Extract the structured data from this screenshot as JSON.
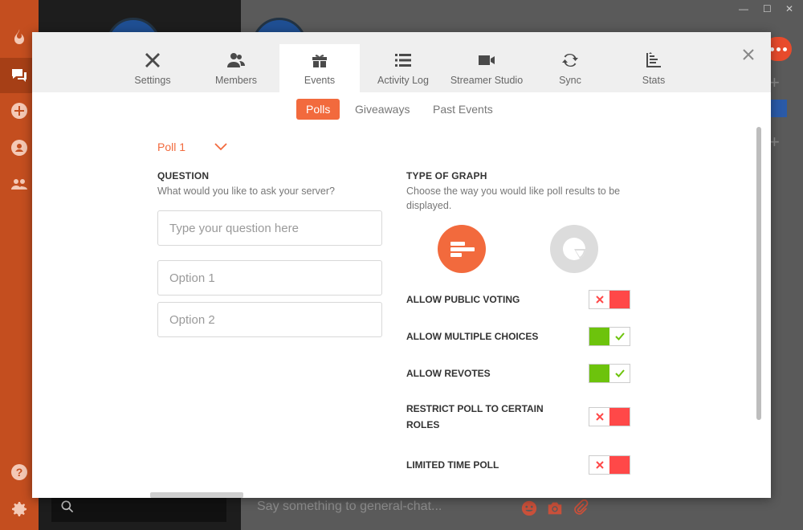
{
  "tabs": [
    {
      "label": "Settings",
      "icon": "tools-icon"
    },
    {
      "label": "Members",
      "icon": "members-icon"
    },
    {
      "label": "Events",
      "icon": "gift-icon",
      "active": true
    },
    {
      "label": "Activity Log",
      "icon": "list-icon"
    },
    {
      "label": "Streamer Studio",
      "icon": "video-camera-icon"
    },
    {
      "label": "Sync",
      "icon": "sync-icon"
    },
    {
      "label": "Stats",
      "icon": "stats-icon"
    }
  ],
  "subtabs": [
    {
      "label": "Polls",
      "active": true
    },
    {
      "label": "Giveaways"
    },
    {
      "label": "Past Events"
    }
  ],
  "poll": {
    "selected": "Poll 1",
    "question_title": "QUESTION",
    "question_sub": "What would you like to ask your server?",
    "question_placeholder": "Type your question here",
    "option1_placeholder": "Option 1",
    "option2_placeholder": "Option 2",
    "graph_title": "TYPE OF GRAPH",
    "graph_sub": "Choose the way you would like poll results to be displayed.",
    "graph_options": [
      "bar-graph-icon",
      "pie-graph-icon"
    ]
  },
  "options": [
    {
      "label": "ALLOW PUBLIC VOTING",
      "state": "off"
    },
    {
      "label": "ALLOW MULTIPLE CHOICES",
      "state": "on"
    },
    {
      "label": "ALLOW REVOTES",
      "state": "on"
    },
    {
      "label": "RESTRICT POLL TO CERTAIN ROLES",
      "state": "off"
    },
    {
      "label": "LIMITED TIME POLL",
      "state": "off"
    }
  ],
  "background": {
    "chat_placeholder": "Say something to general-chat..."
  },
  "colors": {
    "accent": "#f26a3d",
    "toggle_on": "#6dc30c",
    "toggle_off": "#ff4848",
    "rail": "#c44e1f"
  }
}
